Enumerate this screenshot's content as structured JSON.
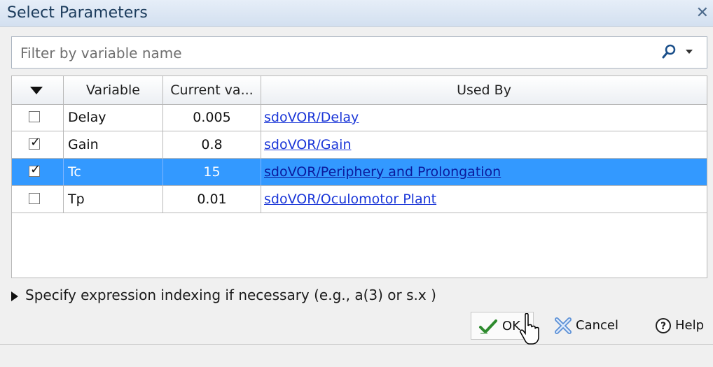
{
  "window": {
    "title": "Select Parameters"
  },
  "filter": {
    "placeholder": "Filter by variable name"
  },
  "table": {
    "headers": [
      "",
      "Variable",
      "Current va...",
      "Used By"
    ],
    "rows": [
      {
        "checked": false,
        "variable": "Delay",
        "value": "0.005",
        "used_by": "sdoVOR/Delay",
        "selected": false
      },
      {
        "checked": true,
        "variable": "Gain",
        "value": "0.8",
        "used_by": "sdoVOR/Gain",
        "selected": false
      },
      {
        "checked": true,
        "variable": "Tc",
        "value": "15",
        "used_by": "sdoVOR/Periphery and Prolongation",
        "selected": true
      },
      {
        "checked": false,
        "variable": "Tp",
        "value": "0.01",
        "used_by": "sdoVOR/Oculomotor Plant",
        "selected": false
      }
    ]
  },
  "expression_hint": "Specify expression indexing if necessary (e.g., a(3) or s.x )",
  "buttons": {
    "ok": "OK",
    "cancel": "Cancel",
    "help": "Help"
  },
  "colors": {
    "selection": "#3399ff",
    "link": "#1a36d8"
  }
}
